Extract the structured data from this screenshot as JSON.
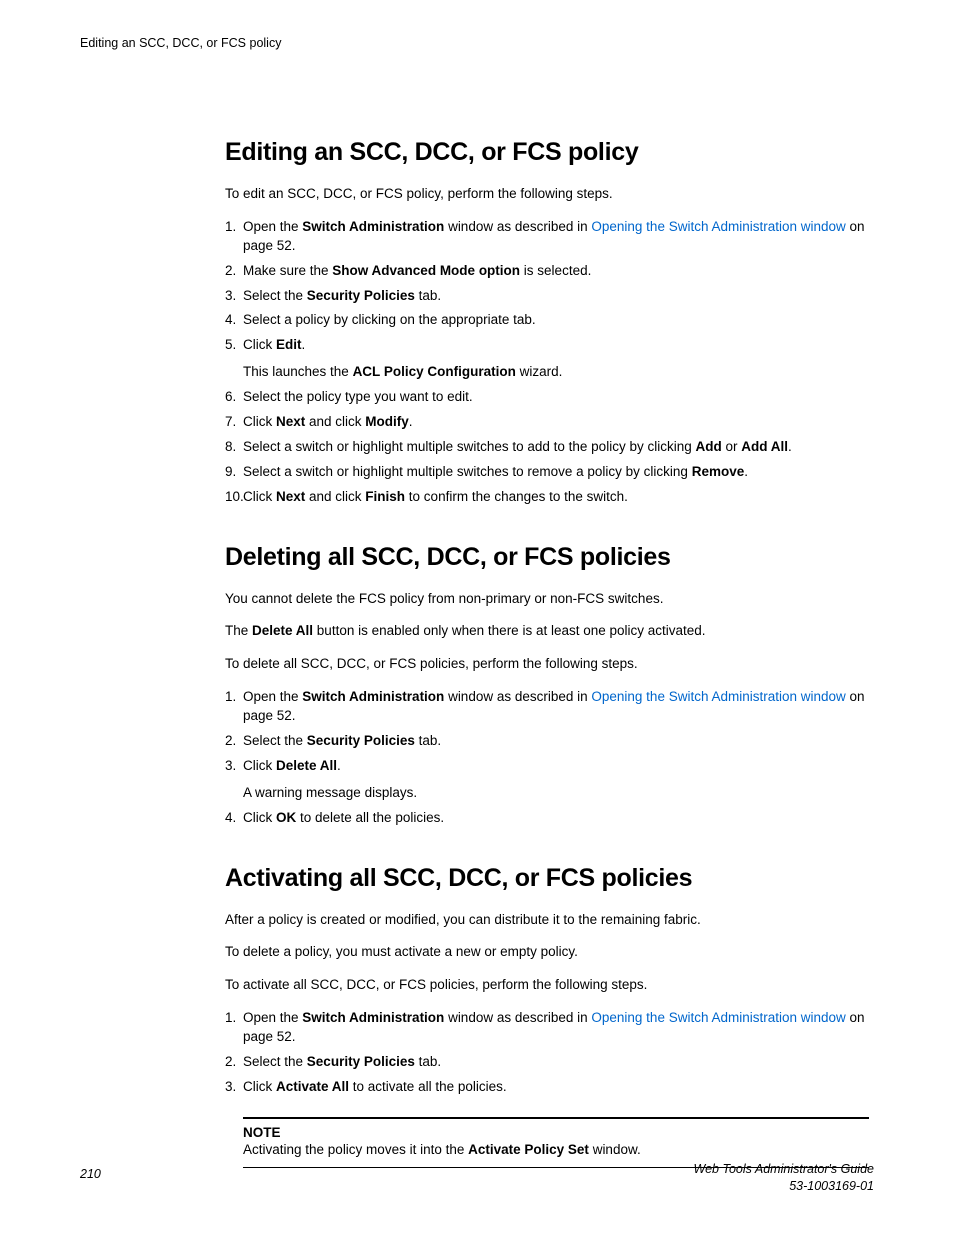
{
  "running_header": "Editing an SCC, DCC, or FCS policy",
  "section1": {
    "title": "Editing an SCC, DCC, or FCS policy",
    "intro": "To edit an SCC, DCC, or FCS policy, perform the following steps.",
    "s1_a": "Open the ",
    "s1_b": "Switch Administration",
    "s1_c": " window as described in ",
    "s1_link": "Opening the Switch Administration window",
    "s1_d": " on page 52.",
    "s2_a": "Make sure the ",
    "s2_b": "Show Advanced Mode option",
    "s2_c": " is selected.",
    "s3_a": "Select the ",
    "s3_b": "Security Policies",
    "s3_c": " tab.",
    "s4": "Select a policy by clicking on the appropriate tab.",
    "s5_a": "Click ",
    "s5_b": "Edit",
    "s5_c": ".",
    "s5_sub_a": "This launches the ",
    "s5_sub_b": "ACL Policy Configuration",
    "s5_sub_c": " wizard.",
    "s6": "Select the policy type you want to edit.",
    "s7_a": "Click ",
    "s7_b": "Next",
    "s7_c": " and click ",
    "s7_d": "Modify",
    "s7_e": ".",
    "s8_a": "Select a switch or highlight multiple switches to add to the policy by clicking ",
    "s8_b": "Add",
    "s8_c": " or ",
    "s8_d": "Add All",
    "s8_e": ".",
    "s9_a": "Select a switch or highlight multiple switches to remove a policy by clicking ",
    "s9_b": "Remove",
    "s9_c": ".",
    "s10_a": "Click ",
    "s10_b": "Next",
    "s10_c": " and click ",
    "s10_d": "Finish",
    "s10_e": " to confirm the changes to the switch."
  },
  "section2": {
    "title": "Deleting all SCC, DCC, or FCS policies",
    "p1": "You cannot delete the FCS policy from non-primary or non-FCS switches.",
    "p2_a": "The ",
    "p2_b": "Delete All",
    "p2_c": " button is enabled only when there is at least one policy activated.",
    "p3": "To delete all SCC, DCC, or FCS policies, perform the following steps.",
    "s1_a": "Open the ",
    "s1_b": "Switch Administration",
    "s1_c": " window as described in ",
    "s1_link": "Opening the Switch Administration window",
    "s1_d": " on page 52.",
    "s2_a": "Select the ",
    "s2_b": "Security Policies",
    "s2_c": " tab.",
    "s3_a": "Click ",
    "s3_b": "Delete All",
    "s3_c": ".",
    "s3_sub": "A warning message displays.",
    "s4_a": "Click ",
    "s4_b": "OK",
    "s4_c": " to delete all the policies."
  },
  "section3": {
    "title": "Activating all SCC, DCC, or FCS policies",
    "p1": "After a policy is created or modified, you can distribute it to the remaining fabric.",
    "p2": "To delete a policy, you must activate a new or empty policy.",
    "p3": "To activate all SCC, DCC, or FCS policies, perform the following steps.",
    "s1_a": "Open the ",
    "s1_b": "Switch Administration",
    "s1_c": " window as described in ",
    "s1_link": "Opening the Switch Administration window",
    "s1_d": " on page 52.",
    "s2_a": "Select the ",
    "s2_b": "Security Policies",
    "s2_c": " tab.",
    "s3_a": "Click ",
    "s3_b": "Activate All",
    "s3_c": " to activate all the policies.",
    "note_label": "NOTE",
    "note_a": "Activating the policy moves it into the ",
    "note_b": "Activate Policy Set",
    "note_c": " window."
  },
  "footer": {
    "page": "210",
    "title": "Web Tools Administrator's Guide",
    "docnum": "53-1003169-01"
  }
}
